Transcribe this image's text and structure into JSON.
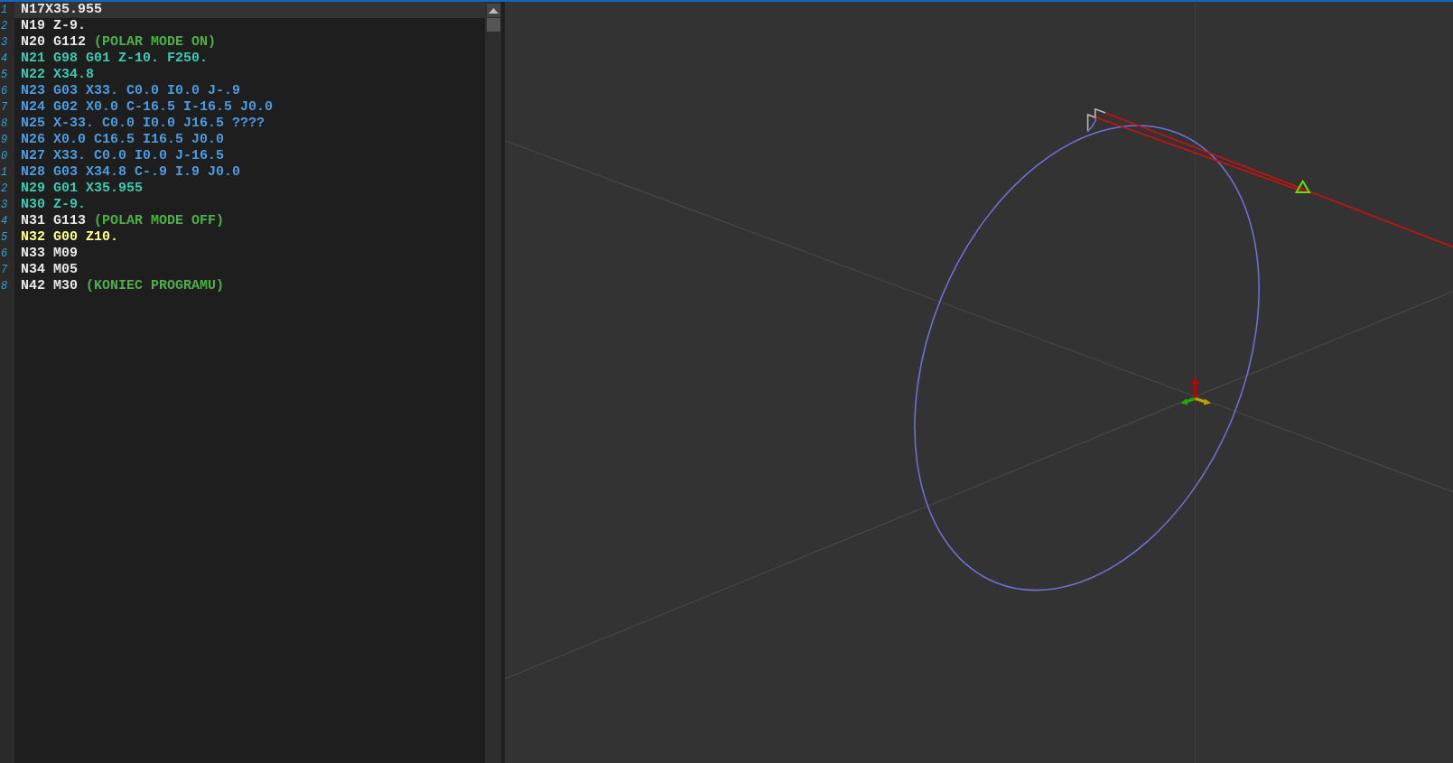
{
  "editor": {
    "lines": [
      {
        "number": "1",
        "selected": true,
        "kind": "plain",
        "code": "N17X35.955"
      },
      {
        "number": "2",
        "selected": false,
        "kind": "plain",
        "code": "N19 Z-9."
      },
      {
        "number": "3",
        "selected": false,
        "kind": "plain",
        "code": "N20 G112",
        "comment": "(POLAR MODE ON)"
      },
      {
        "number": "4",
        "selected": false,
        "kind": "feed",
        "code": "N21 G98 G01 Z-10. F250."
      },
      {
        "number": "5",
        "selected": false,
        "kind": "feed",
        "code": "N22 X34.8"
      },
      {
        "number": "6",
        "selected": false,
        "kind": "arc",
        "code": "N23 G03 X33. C0.0 I0.0 J-.9"
      },
      {
        "number": "7",
        "selected": false,
        "kind": "arc",
        "code": "N24 G02 X0.0 C-16.5 I-16.5 J0.0"
      },
      {
        "number": "8",
        "selected": false,
        "kind": "arc",
        "code": "N25 X-33. C0.0 I0.0 J16.5 ????"
      },
      {
        "number": "9",
        "selected": false,
        "kind": "arc",
        "code": "N26 X0.0 C16.5 I16.5 J0.0"
      },
      {
        "number": "0",
        "selected": false,
        "kind": "arc",
        "code": "N27 X33. C0.0 I0.0 J-16.5"
      },
      {
        "number": "1",
        "selected": false,
        "kind": "arc",
        "code": "N28 G03 X34.8 C-.9 I.9 J0.0"
      },
      {
        "number": "2",
        "selected": false,
        "kind": "feed",
        "code": "N29 G01 X35.955"
      },
      {
        "number": "3",
        "selected": false,
        "kind": "feed",
        "code": "N30 Z-9."
      },
      {
        "number": "4",
        "selected": false,
        "kind": "plain",
        "code": "N31 G113",
        "comment": "(POLAR MODE OFF)"
      },
      {
        "number": "5",
        "selected": false,
        "kind": "rapid",
        "code": "N32 G00 Z10."
      },
      {
        "number": "6",
        "selected": false,
        "kind": "plain",
        "code": "N33 M09"
      },
      {
        "number": "7",
        "selected": false,
        "kind": "plain",
        "code": "N34 M05"
      },
      {
        "number": "8",
        "selected": false,
        "kind": "plain",
        "code": "N42 M30",
        "comment": "(KONIEC PROGRAMU)"
      }
    ]
  }
}
